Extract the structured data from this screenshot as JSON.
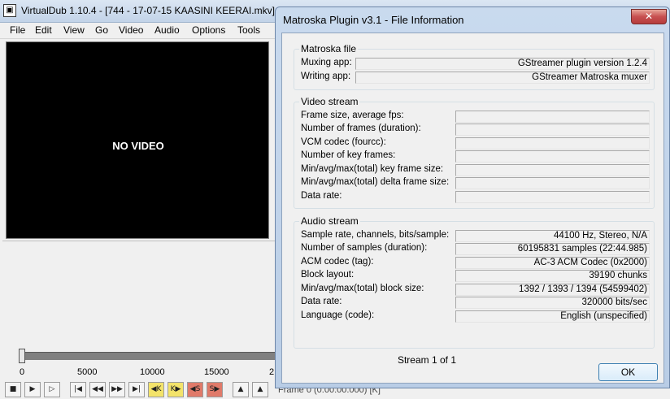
{
  "vd": {
    "title": "VirtualDub 1.10.4 - [744 - 17-07-15 KAASINI KEERAI.mkv]",
    "menu": [
      "File",
      "Edit",
      "View",
      "Go",
      "Video",
      "Audio",
      "Options",
      "Tools"
    ],
    "no_video": "NO VIDEO",
    "ticks": [
      "0",
      "5000",
      "10000",
      "15000",
      "2"
    ],
    "frame_info": "Frame 0 (0:00:00.000) [K]"
  },
  "dialog": {
    "title": "Matroska Plugin v3.1 - File Information",
    "close_glyph": "✕",
    "matroska": {
      "label": "Matroska file",
      "rows": [
        {
          "label": "Muxing app:",
          "value": "GStreamer plugin version 1.2.4"
        },
        {
          "label": "Writing app:",
          "value": "GStreamer Matroska muxer"
        }
      ]
    },
    "video": {
      "label": "Video stream",
      "rows": [
        {
          "label": "Frame size, average fps:",
          "value": ""
        },
        {
          "label": "Number of frames (duration):",
          "value": ""
        },
        {
          "label": "VCM codec (fourcc):",
          "value": ""
        },
        {
          "label": "Number of key frames:",
          "value": ""
        },
        {
          "label": "Min/avg/max(total) key frame size:",
          "value": ""
        },
        {
          "label": "Min/avg/max(total) delta frame size:",
          "value": ""
        },
        {
          "label": "Data rate:",
          "value": ""
        }
      ]
    },
    "audio": {
      "label": "Audio stream",
      "rows": [
        {
          "label": "Sample rate, channels, bits/sample:",
          "value": "44100 Hz, Stereo, N/A"
        },
        {
          "label": "Number of samples (duration):",
          "value": "60195831 samples (22:44.985)"
        },
        {
          "label": "ACM codec (tag):",
          "value": "AC-3 ACM Codec (0x2000)"
        },
        {
          "label": "Block layout:",
          "value": "39190 chunks"
        },
        {
          "label": "Min/avg/max(total) block size:",
          "value": "1392 / 1393 / 1394 (54599402)"
        },
        {
          "label": "Data rate:",
          "value": "320000 bits/sec"
        },
        {
          "label": "Language (code):",
          "value": "English (unspecified)"
        }
      ]
    },
    "stream_of": "Stream 1 of 1",
    "ok_label": "OK"
  }
}
